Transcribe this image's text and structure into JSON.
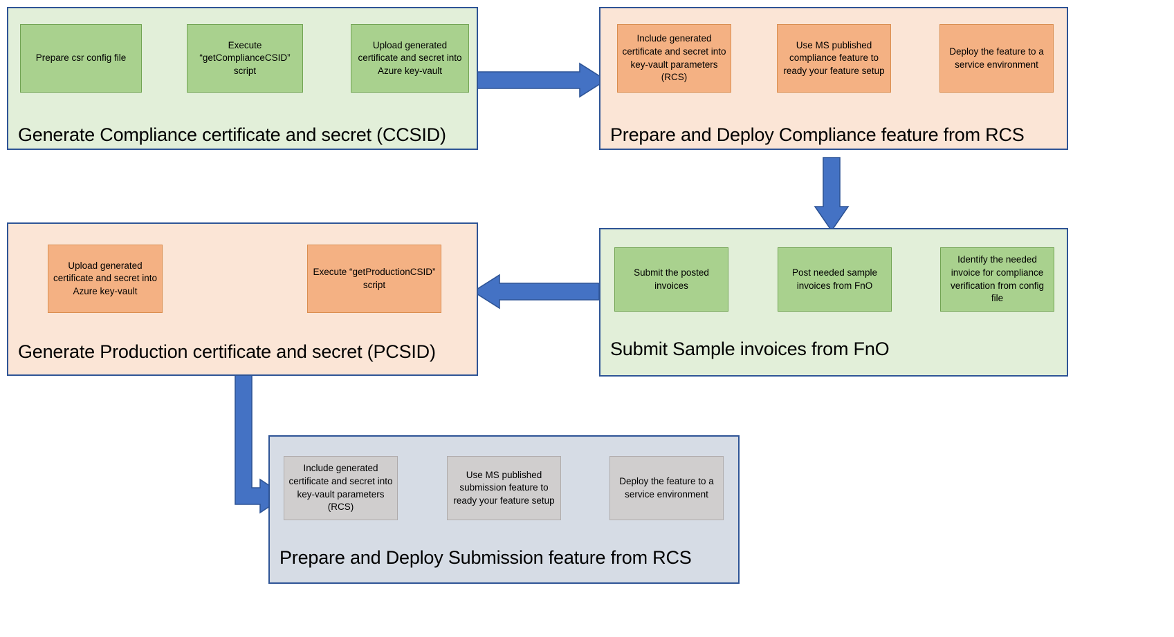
{
  "diagram": {
    "title_visible": false,
    "colors": {
      "green_panel_bg": "#E2EFD9",
      "green_node_bg": "#A9D18E",
      "green_node_border": "#71A352",
      "orange_panel_bg": "#FBE5D6",
      "orange_node_bg": "#F4B183",
      "orange_node_border": "#D98D4F",
      "blue_panel_bg": "#D6DCE5",
      "gray_node_bg": "#D0CECE",
      "gray_node_border": "#AFABAB",
      "panel_border": "#2E5496",
      "big_arrow_fill": "#4472C4",
      "big_arrow_stroke": "#2E5496",
      "green_arrow": "#70AD47",
      "orange_arrow": "#ED7D31",
      "black_arrow": "#000000"
    },
    "panels": [
      {
        "id": "ccsid",
        "title": "Generate Compliance certificate and secret (CCSID)",
        "theme": "green",
        "flow_direction": "left-to-right",
        "nodes": [
          {
            "id": "ccsid-n1",
            "label": "Prepare csr config file"
          },
          {
            "id": "ccsid-n2",
            "label": "Execute “getComplianceCSID” script"
          },
          {
            "id": "ccsid-n3",
            "label": "Upload generated certificate and secret into Azure key-vault"
          }
        ]
      },
      {
        "id": "compliance-rcs",
        "title": "Prepare and Deploy Compliance feature from RCS",
        "theme": "orange",
        "flow_direction": "left-to-right",
        "nodes": [
          {
            "id": "crcs-n1",
            "label": "Include generated certificate and secret into key-vault parameters (RCS)"
          },
          {
            "id": "crcs-n2",
            "label": "Use MS published compliance feature to ready your feature setup"
          },
          {
            "id": "crcs-n3",
            "label": "Deploy the feature to a service environment"
          }
        ]
      },
      {
        "id": "pcsid",
        "title": "Generate Production certificate and secret (PCSID)",
        "theme": "orange",
        "flow_direction": "right-to-left",
        "nodes": [
          {
            "id": "pcsid-n1",
            "label": "Upload generated certificate and secret into Azure key-vault"
          },
          {
            "id": "pcsid-n2",
            "label": "Execute “getProductionCSID” script"
          }
        ]
      },
      {
        "id": "submit-invoices",
        "title": "Submit Sample invoices from FnO",
        "theme": "green",
        "flow_direction": "right-to-left",
        "nodes": [
          {
            "id": "si-n1",
            "label": "Submit the posted invoices"
          },
          {
            "id": "si-n2",
            "label": "Post needed sample invoices from FnO"
          },
          {
            "id": "si-n3",
            "label": "Identify the needed invoice for compliance verification from config file"
          }
        ]
      },
      {
        "id": "submission-rcs",
        "title": "Prepare and Deploy Submission feature from RCS",
        "theme": "blue",
        "flow_direction": "left-to-right",
        "nodes": [
          {
            "id": "srcs-n1",
            "label": "Include generated certificate and secret into key-vault parameters (RCS)"
          },
          {
            "id": "srcs-n2",
            "label": "Use MS published submission feature to ready your feature setup"
          },
          {
            "id": "srcs-n3",
            "label": "Deploy the feature to a service environment"
          }
        ]
      }
    ],
    "connectors": [
      {
        "id": "conn-ccsid-to-compliance",
        "from": "ccsid",
        "to": "compliance-rcs",
        "style": "thick-blue",
        "direction": "right"
      },
      {
        "id": "conn-compliance-to-submit",
        "from": "compliance-rcs",
        "to": "submit-invoices",
        "style": "thick-blue",
        "direction": "down"
      },
      {
        "id": "conn-submit-to-pcsid",
        "from": "submit-invoices",
        "to": "pcsid",
        "style": "thick-blue",
        "direction": "left"
      },
      {
        "id": "conn-pcsid-to-submission",
        "from": "pcsid",
        "to": "submission-rcs",
        "style": "thick-blue",
        "direction": "down-right"
      }
    ]
  }
}
